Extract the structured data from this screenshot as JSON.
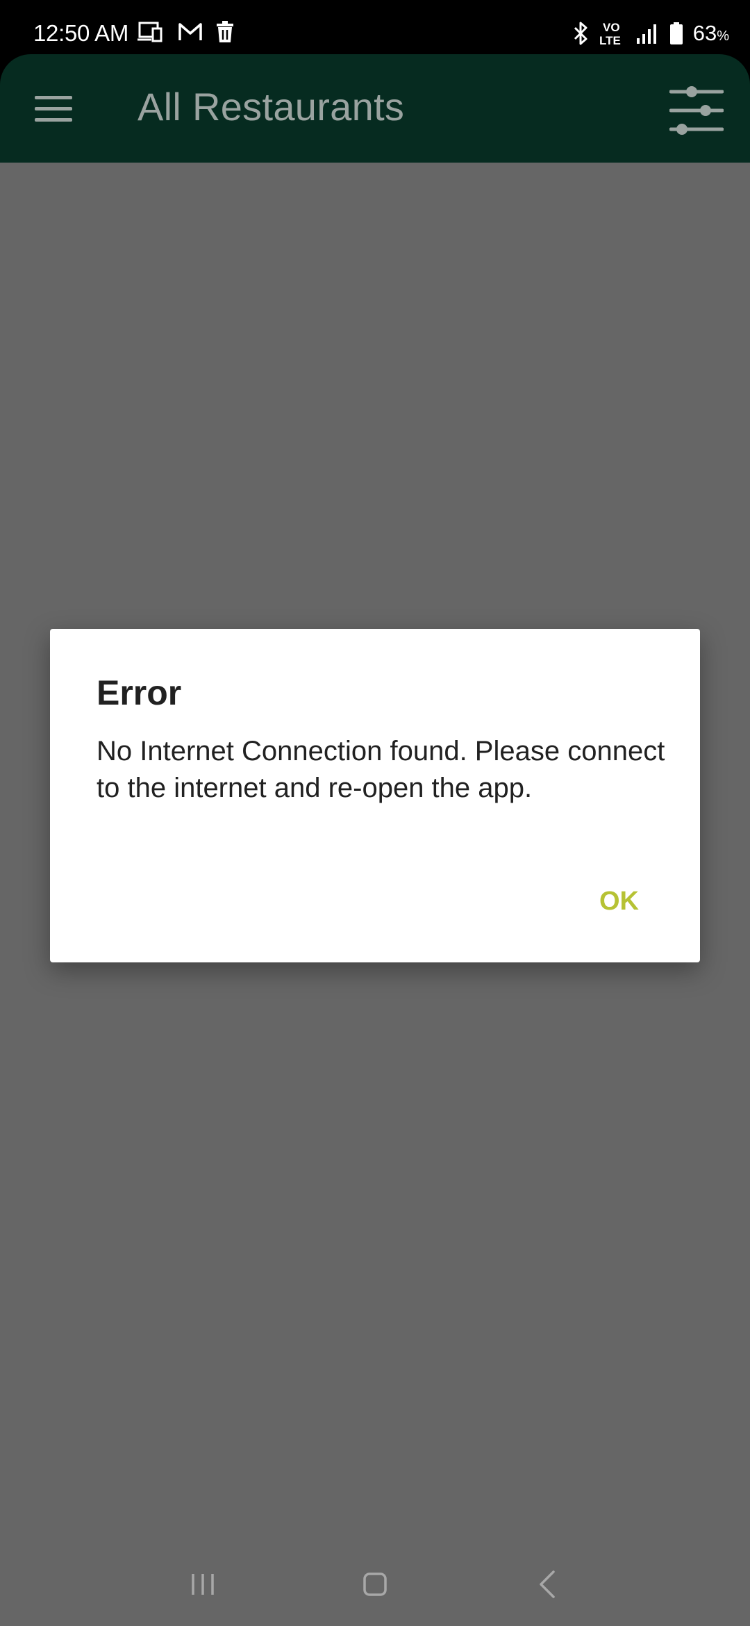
{
  "status_bar": {
    "time": "12:50 AM",
    "left_icons": [
      "screen-cast-icon",
      "gmail-icon",
      "delete-icon"
    ],
    "right_icons": [
      "bluetooth-icon",
      "volte-icon",
      "signal-icon",
      "battery-icon"
    ],
    "volte_top": "VO",
    "volte_bottom": "LTE",
    "battery_value": "63",
    "battery_unit": "%"
  },
  "app_bar": {
    "menu_icon": "hamburger-menu-icon",
    "title": "All Restaurants",
    "filter_icon": "filter-sliders-icon"
  },
  "dialog": {
    "title": "Error",
    "message": "No Internet Connection found. Please connect to the internet and re-open the app.",
    "ok_label": "OK",
    "ok_color": "#b6c234"
  },
  "nav_bar": {
    "items": [
      "recent-apps-icon",
      "home-icon",
      "back-icon"
    ]
  },
  "colors": {
    "app_bar_bg": "#062b20",
    "scrim": "#666666"
  }
}
